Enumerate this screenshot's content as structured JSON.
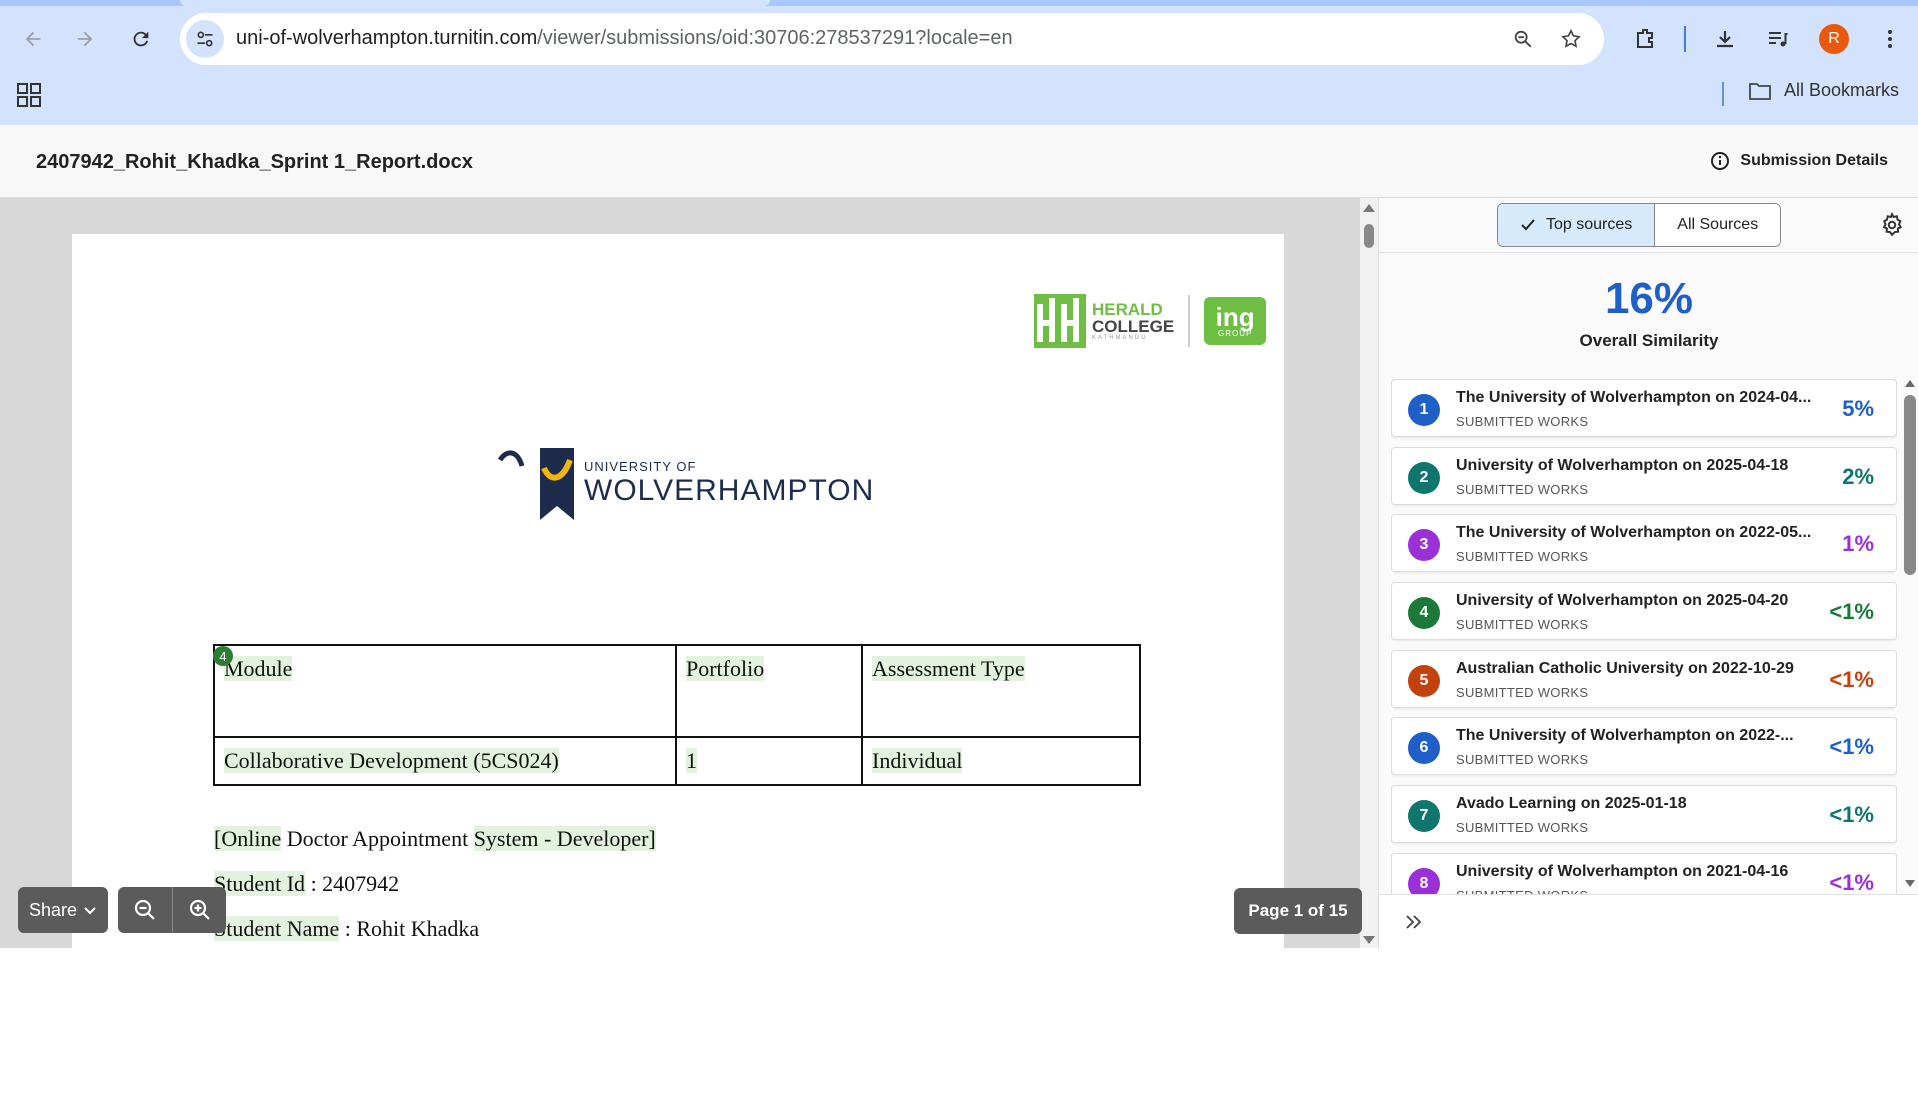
{
  "browser": {
    "url_host": "uni-of-wolverhampton.turnitin.com",
    "url_path": "/viewer/submissions/oid:30706:278537291?locale=en",
    "avatar_letter": "R",
    "bookmarks_label": "All Bookmarks"
  },
  "header": {
    "title": "2407942_Rohit_Khadka_Sprint 1_Report.docx",
    "submission_details": "Submission Details"
  },
  "document": {
    "herald_line1": "HERALD",
    "herald_line2": "COLLEGE",
    "herald_line3": "KATHMANDU",
    "ing_label": "ing",
    "ing_sub": "GROUP",
    "uw_small": "UNIVERSITY OF",
    "uw_big": "WOLVERHAMPTON",
    "match_marker": "4",
    "table": {
      "row1": [
        "Module",
        "Portfolio",
        "Assessment Type"
      ],
      "row2": [
        "Collaborative Development (5CS024)",
        "1",
        "Individual"
      ]
    },
    "project_open": "[Online",
    "project_mid": " Doctor Appointment ",
    "project_close": "System - Developer]",
    "student_id_label": "Student Id",
    "student_id_value": " : 2407942",
    "student_name_label": "Student Name",
    "student_name_value": " : Rohit Khadka"
  },
  "controls": {
    "share_label": "Share",
    "page_indicator": "Page 1 of 15"
  },
  "panel": {
    "tab_top": "Top sources",
    "tab_all": "All Sources",
    "overall_pct": "16%",
    "overall_label": "Overall Similarity",
    "sources": [
      {
        "num": "1",
        "name": "The University of Wolverhampton on 2024-04...",
        "type": "SUBMITTED WORKS",
        "pct": "5%",
        "color": "#1e5fc9"
      },
      {
        "num": "2",
        "name": "University of Wolverhampton on 2025-04-18",
        "type": "SUBMITTED WORKS",
        "pct": "2%",
        "color": "#0f766e"
      },
      {
        "num": "3",
        "name": "The University of Wolverhampton on 2022-05...",
        "type": "SUBMITTED WORKS",
        "pct": "1%",
        "color": "#9b30d9"
      },
      {
        "num": "4",
        "name": "University of Wolverhampton on 2025-04-20",
        "type": "SUBMITTED WORKS",
        "pct": "<1%",
        "color": "#1b7a3a"
      },
      {
        "num": "5",
        "name": "Australian Catholic University on 2022-10-29",
        "type": "SUBMITTED WORKS",
        "pct": "<1%",
        "color": "#c2410c"
      },
      {
        "num": "6",
        "name": "The University of Wolverhampton on 2022-...",
        "type": "SUBMITTED WORKS",
        "pct": "<1%",
        "color": "#1e5fc9"
      },
      {
        "num": "7",
        "name": "Avado Learning on 2025-01-18",
        "type": "SUBMITTED WORKS",
        "pct": "<1%",
        "color": "#0f766e"
      },
      {
        "num": "8",
        "name": "University of Wolverhampton on 2021-04-16",
        "type": "SUBMITTED WORKS",
        "pct": "<1%",
        "color": "#9b30d9"
      }
    ]
  }
}
